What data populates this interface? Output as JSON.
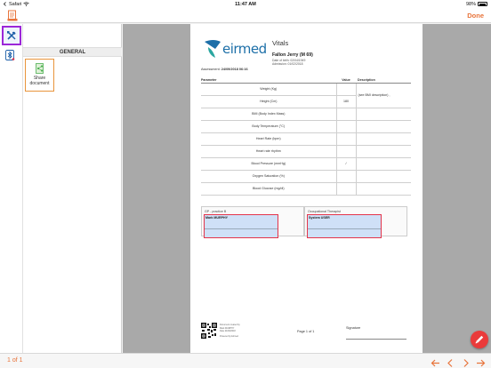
{
  "status_bar": {
    "carrier": "Safari",
    "time": "11:47 AM",
    "battery": "98%"
  },
  "nav": {
    "done_label": "Done"
  },
  "side_panel": {
    "section": "GENERAL",
    "tiles": [
      {
        "label": "Share document",
        "icon": "share-icon"
      }
    ]
  },
  "document": {
    "logo_text": "eirmed",
    "title": "Vitals",
    "patient_name": "Fallon Jerry (M 69)",
    "dob_line": "Date of birth: 02/04/1949",
    "admission_line": "Admission: 01/02/2018",
    "assessment_label": "Assessment:",
    "assessment_value": "24/09/2018 06:16",
    "table": {
      "headers": [
        "Parameter",
        "Value",
        "Description"
      ],
      "rows": [
        {
          "param": "Weight (Kg)",
          "value": "",
          "desc": ""
        },
        {
          "param": "Height (Cm)",
          "value": "180",
          "desc": ""
        },
        {
          "param": "BMI (Body Index Mass)",
          "value": "",
          "desc": ""
        },
        {
          "param": "Body Temperature (°C)",
          "value": "",
          "desc": ""
        },
        {
          "param": "Heart Rate (bpm)",
          "value": "",
          "desc": ""
        },
        {
          "param": "Heart rate rhythm",
          "value": "",
          "desc": ""
        },
        {
          "param": "Blood Pressure (mmHg)",
          "value": "/",
          "desc": ""
        },
        {
          "param": "Oxygen Saturation (%)",
          "value": "",
          "desc": ""
        },
        {
          "param": "Blood Glucose (mg/dl)",
          "value": "",
          "desc": ""
        }
      ],
      "merged_desc": "(see BMI description) ,"
    },
    "signatures": [
      {
        "role": "GP - practice B",
        "name": "Mark MURPHY"
      },
      {
        "role": "Occupational Therapist",
        "name": "System USER"
      }
    ],
    "footer": {
      "meta": [
        "Document created by",
        "Mark MURPHY",
        "Date 24/09/2018",
        "Powered by Eirmed"
      ],
      "page_label": "Page 1 of 1",
      "signature_label": "Signature"
    }
  },
  "bottom_bar": {
    "page_count": "1 of 1"
  },
  "colors": {
    "accent": "#e8743b",
    "active_tool": "#9c27d8",
    "fab": "#ea3b3b",
    "field_border": "#e4344a"
  }
}
